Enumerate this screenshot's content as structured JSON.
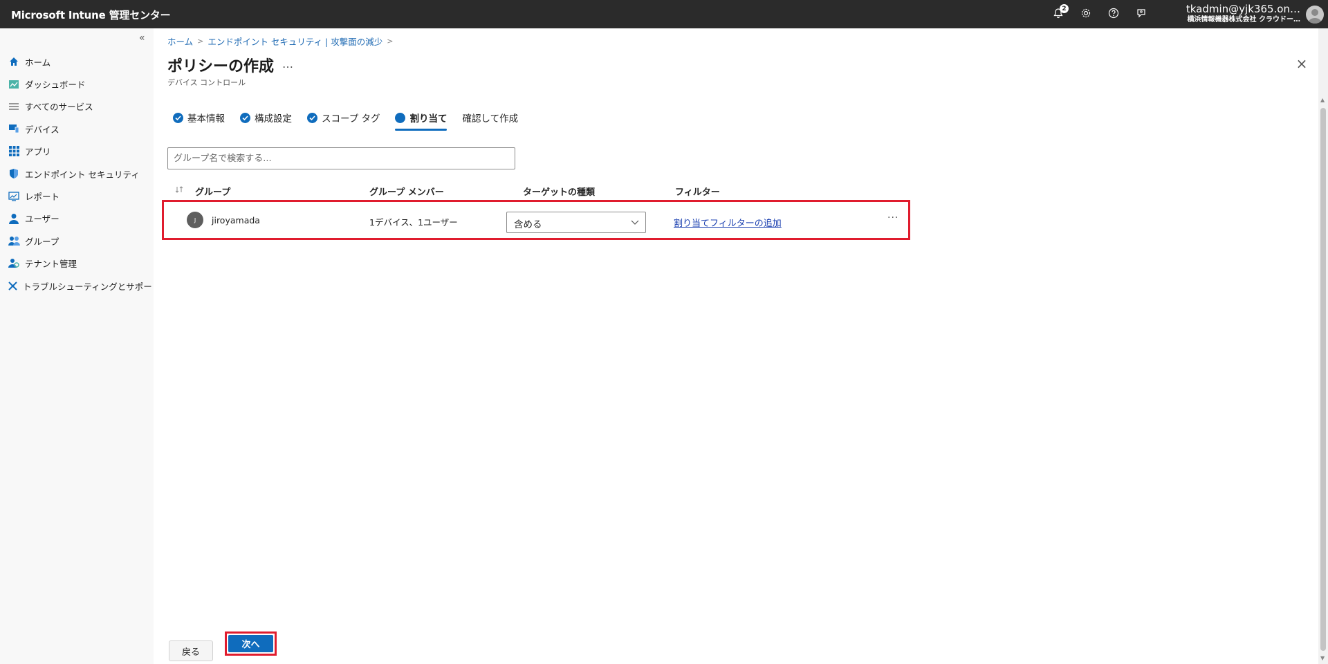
{
  "topbar": {
    "app_title": "Microsoft Intune 管理センター",
    "notification_count": "2",
    "account_email": "tkadmin@yjk365.on…",
    "account_org": "横浜情報機器株式会社 クラウドー…"
  },
  "sidebar": {
    "collapse_label": "«",
    "items": [
      {
        "label": "ホーム",
        "icon": "home-icon"
      },
      {
        "label": "ダッシュボード",
        "icon": "dashboard-icon"
      },
      {
        "label": "すべてのサービス",
        "icon": "list-icon"
      },
      {
        "label": "デバイス",
        "icon": "device-icon"
      },
      {
        "label": "アプリ",
        "icon": "apps-grid-icon"
      },
      {
        "label": "エンドポイント セキュリティ",
        "icon": "shield-icon"
      },
      {
        "label": "レポート",
        "icon": "report-icon"
      },
      {
        "label": "ユーザー",
        "icon": "user-icon"
      },
      {
        "label": "グループ",
        "icon": "group-icon"
      },
      {
        "label": "テナント管理",
        "icon": "tenant-icon"
      },
      {
        "label": "トラブルシューティングとサポート",
        "icon": "wrench-icon"
      }
    ]
  },
  "breadcrumb": {
    "items": [
      "ホーム",
      "エンドポイント セキュリティ | 攻撃面の減少"
    ],
    "separator": ">"
  },
  "page": {
    "title": "ポリシーの作成",
    "more": "…",
    "subtitle": "デバイス コントロール",
    "close": "×"
  },
  "steps": [
    {
      "label": "基本情報",
      "state": "done"
    },
    {
      "label": "構成設定",
      "state": "done"
    },
    {
      "label": "スコープ タグ",
      "state": "done"
    },
    {
      "label": "割り当て",
      "state": "active"
    },
    {
      "label": "確認して作成",
      "state": "pending"
    }
  ],
  "search": {
    "placeholder": "グループ名で検索する..."
  },
  "table": {
    "headers": {
      "group": "グループ",
      "members": "グループ メンバー",
      "target": "ターゲットの種類",
      "filter": "フィルター"
    },
    "rows": [
      {
        "avatar_initial": "J",
        "group": "jiroyamada",
        "members": "1デバイス、1ユーザー",
        "target": "含める",
        "filter_link": "割り当てフィルターの追加",
        "more": "···"
      }
    ]
  },
  "footer": {
    "back_label": "戻る",
    "next_label": "次へ"
  },
  "colors": {
    "accent": "#0f6cbd",
    "highlight": "#e01c2e",
    "topbar": "#2b2b2b"
  }
}
